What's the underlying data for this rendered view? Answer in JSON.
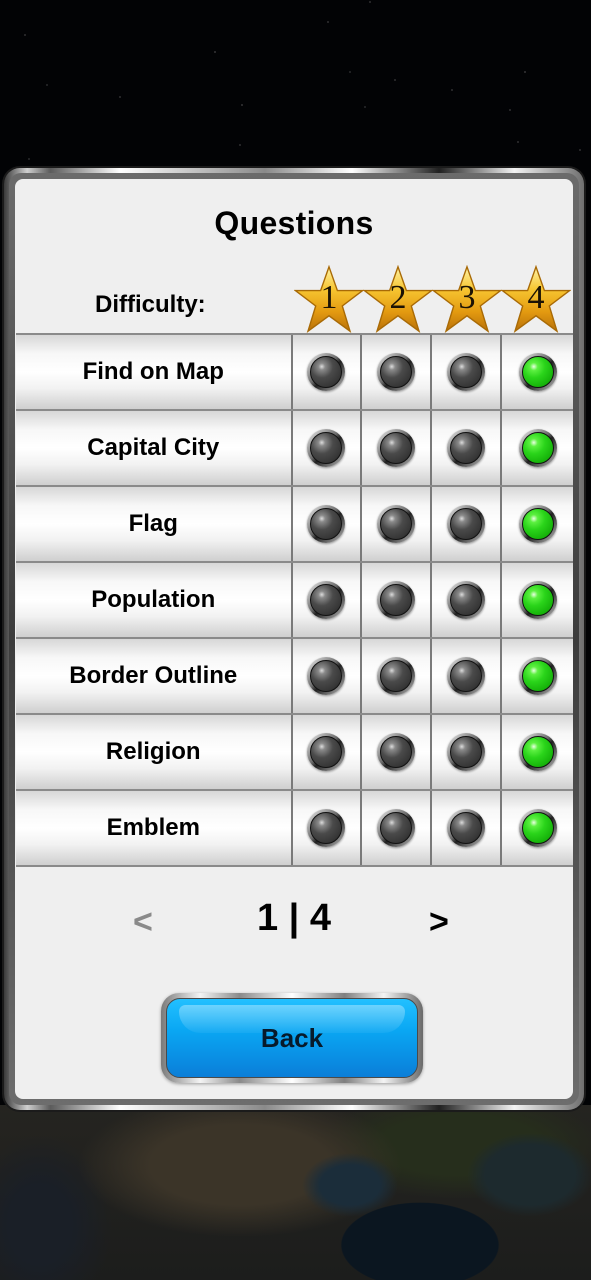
{
  "screen": {
    "title": "Questions",
    "difficulty_label": "Difficulty:",
    "difficulty_levels": [
      "1",
      "2",
      "3",
      "4"
    ],
    "selected_difficulty": 4
  },
  "questions": [
    {
      "label": "Find on Map",
      "lights": [
        "off",
        "off",
        "off",
        "on"
      ]
    },
    {
      "label": "Capital City",
      "lights": [
        "off",
        "off",
        "off",
        "on"
      ]
    },
    {
      "label": "Flag",
      "lights": [
        "off",
        "off",
        "off",
        "on"
      ]
    },
    {
      "label": "Population",
      "lights": [
        "off",
        "off",
        "off",
        "on"
      ]
    },
    {
      "label": "Border Outline",
      "lights": [
        "off",
        "off",
        "off",
        "on"
      ]
    },
    {
      "label": "Religion",
      "lights": [
        "off",
        "off",
        "off",
        "on"
      ]
    },
    {
      "label": "Emblem",
      "lights": [
        "off",
        "off",
        "off",
        "on"
      ]
    }
  ],
  "pager": {
    "prev_label": "<",
    "next_label": ">",
    "status": "1 | 4",
    "current_page": 1,
    "total_pages": 4,
    "prev_enabled": false
  },
  "back_button": {
    "label": "Back"
  },
  "icons": {
    "star": "gold-star-icon",
    "light_off": "gray-indicator-icon",
    "light_on": "green-indicator-icon"
  },
  "colors": {
    "light_on": "#2ad41a",
    "light_off": "#4a4a4a",
    "button": "#0aa7f3",
    "star": "#f2b320",
    "pager_disabled": "#8a8a8a"
  }
}
